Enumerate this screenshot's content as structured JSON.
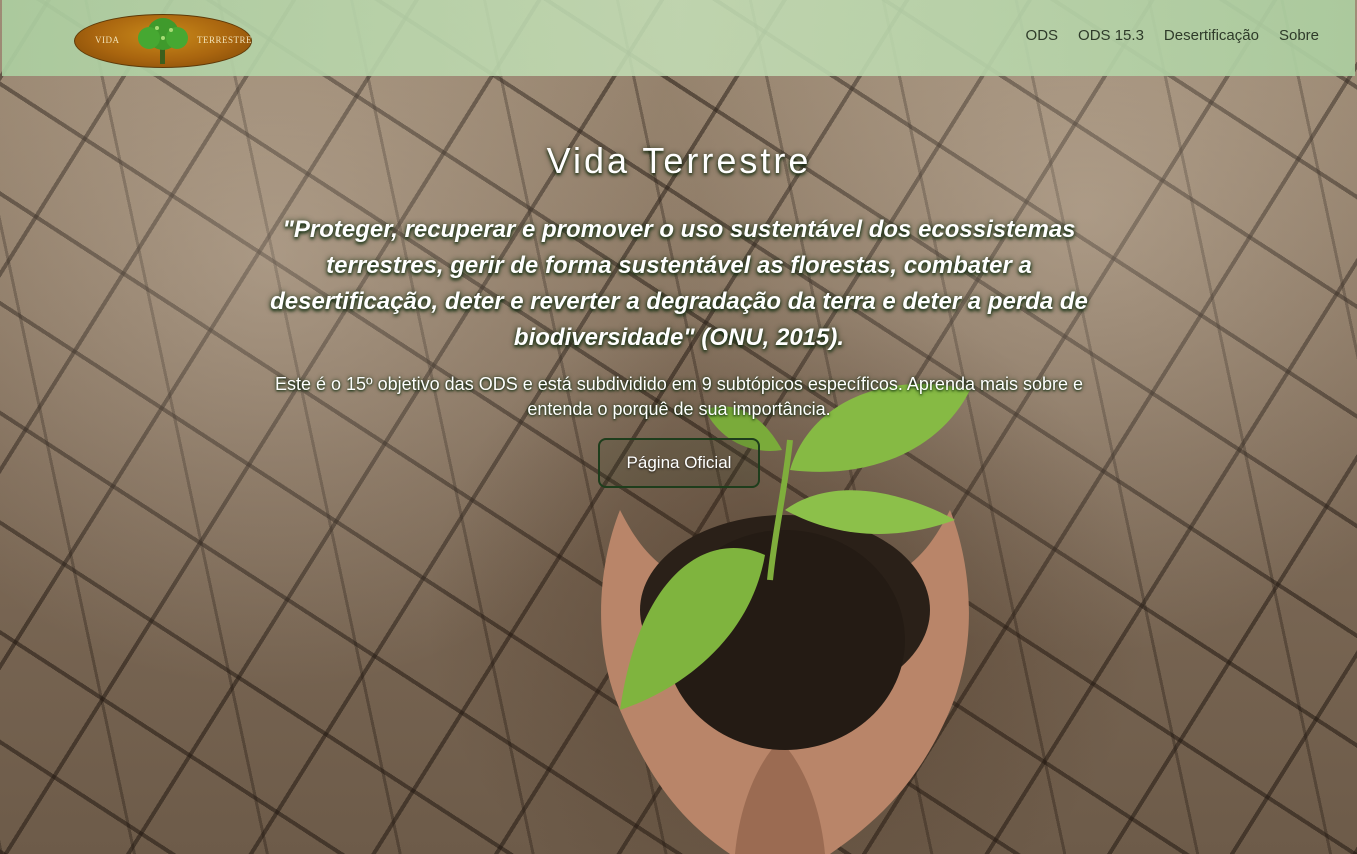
{
  "logo": {
    "text_left": "VIDA",
    "text_right": "TERRESTRE"
  },
  "nav": {
    "items": [
      "ODS",
      "ODS 15.3",
      "Desertificação",
      "Sobre"
    ]
  },
  "hero": {
    "title": "Vida Terrestre",
    "quote": "\"Proteger, recuperar e promover o uso sustentável dos ecossistemas terrestres, gerir de forma sustentável as florestas, combater a desertificação, deter e reverter a degradação da terra e deter a perda de biodiversidade\" (ONU, 2015).",
    "description": "Este é o 15º objetivo das ODS e está subdividido em 9 subtópicos específicos. Aprenda mais sobre e entenda o porquê de sua importância.",
    "button_label": "Página Oficial"
  },
  "colors": {
    "navbar": "#b6d4a8",
    "logo": "#a9650f",
    "text": "#ffffff",
    "button_border": "#1e3d1c"
  },
  "icons": {
    "logo_tree": "tree-icon",
    "hero_image": "plant-in-hands-icon"
  }
}
